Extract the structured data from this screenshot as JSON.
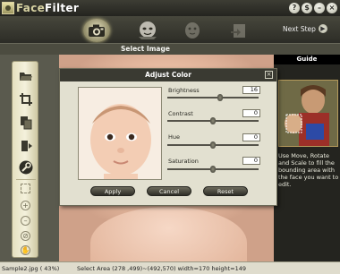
{
  "app": {
    "title_part1": "Face",
    "title_part2": "Filter"
  },
  "window_buttons": [
    "?",
    "$",
    "–",
    "×"
  ],
  "toolbar": {
    "steps": [
      "camera-step",
      "makeover-step",
      "face-step",
      "share-step"
    ],
    "next_step": "Next Step"
  },
  "section": {
    "title": "Select Image"
  },
  "guide": {
    "tab": "Guide",
    "text": "Use Move, Rotate and Scale to fill the bounding area with the face you want to edit."
  },
  "dialog": {
    "title": "Adjust Color",
    "controls": [
      {
        "label": "Brightness",
        "value": "16",
        "level": 0.58
      },
      {
        "label": "Contrast",
        "value": "0",
        "level": 0.5
      },
      {
        "label": "Hue",
        "value": "0",
        "level": 0.5
      },
      {
        "label": "Saturation",
        "value": "0",
        "level": 0.5
      }
    ],
    "buttons": {
      "apply": "Apply",
      "cancel": "Cancel",
      "reset": "Reset"
    }
  },
  "status": {
    "file": "Sample2.jpg ( 43%)",
    "area": "Select Area (278 ,499)~(492,570) width=170 height=149"
  },
  "colors": {
    "accent": "#4c4c40",
    "panel": "#e2e0d0",
    "statusbar": "#dfdccd"
  }
}
